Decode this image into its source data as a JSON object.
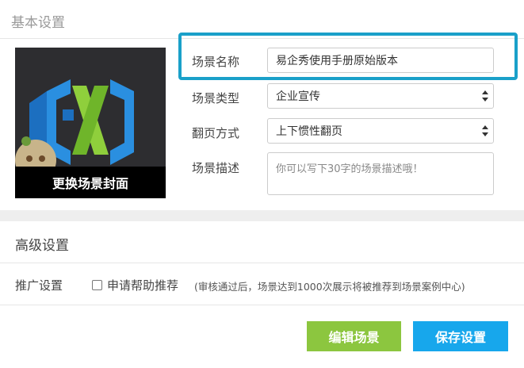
{
  "section_basic": {
    "title": "基本设置"
  },
  "cover": {
    "button_label": "更换场景封面"
  },
  "form": {
    "name_label": "场景名称",
    "name_value": "易企秀使用手册原始版本",
    "type_label": "场景类型",
    "type_value": "企业宣传",
    "flip_label": "翻页方式",
    "flip_value": "上下惯性翻页",
    "desc_label": "场景描述",
    "desc_placeholder": "你可以写下30字的场景描述哦！"
  },
  "section_advanced": {
    "title": "高级设置"
  },
  "promotion": {
    "label": "推广设置",
    "checkbox_label": "申请帮助推荐",
    "checked": false,
    "note": "(审核通过后，场景达到1000次展示将被推荐到场景案例中心)"
  },
  "actions": {
    "edit_label": "编辑场景",
    "save_label": "保存设置"
  },
  "colors": {
    "highlight": "#1aa0c9",
    "edit_button": "#8cc63f",
    "save_button": "#17a7ec",
    "logo_blue": "#2a8fe0",
    "logo_green": "#8fcf3c"
  }
}
